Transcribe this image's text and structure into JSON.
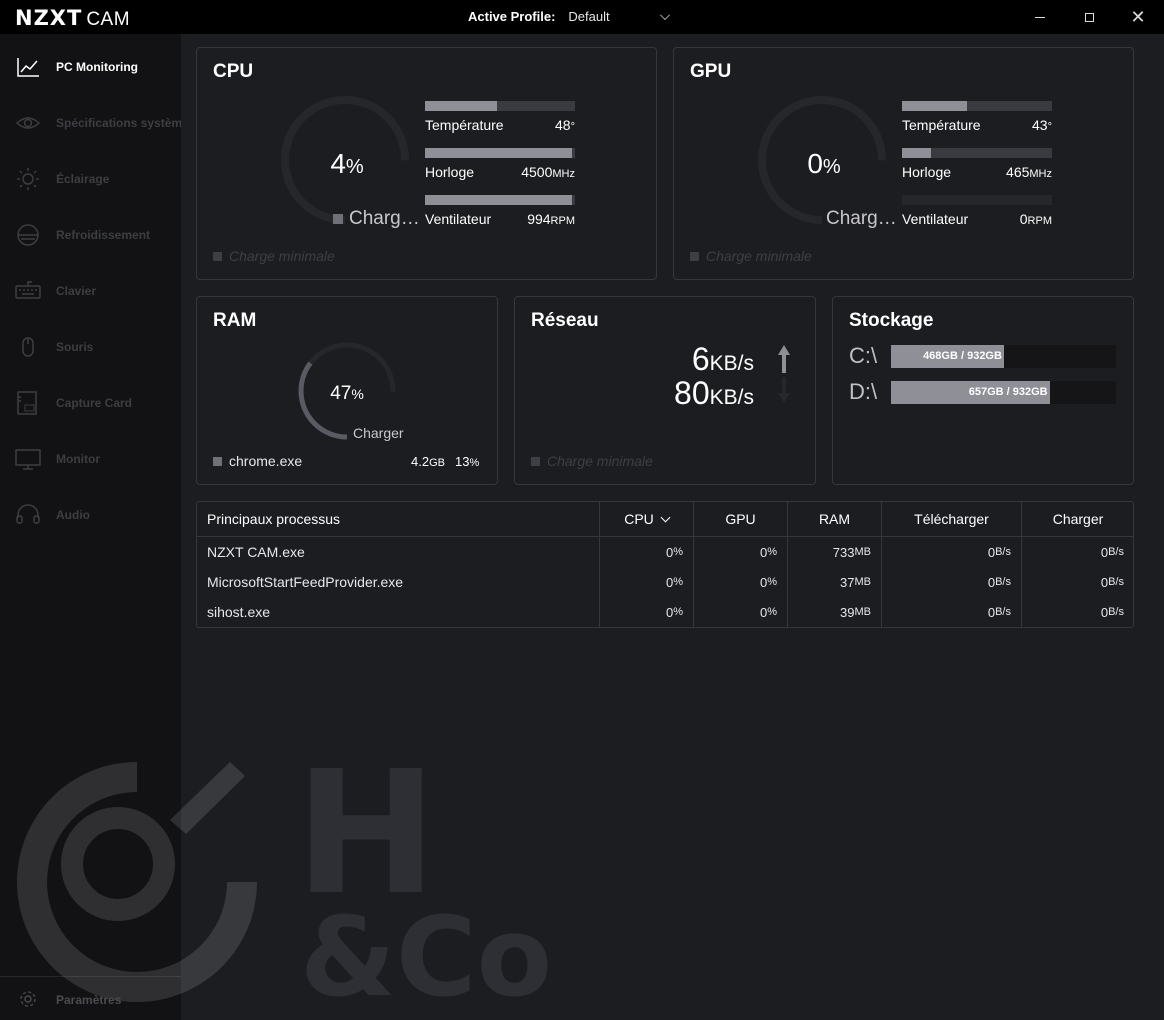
{
  "titlebar": {
    "brand": "NZXT",
    "app": "CAM",
    "profile_label": "Active Profile:",
    "profile_value": "Default"
  },
  "sidebar": {
    "items": [
      {
        "label": "PC Monitoring",
        "icon": "chart-line-icon",
        "active": true
      },
      {
        "label": "Spécifications système",
        "icon": "eye-icon",
        "active": false
      },
      {
        "label": "Éclairage",
        "icon": "sun-icon",
        "active": false
      },
      {
        "label": "Refroidissement",
        "icon": "fan-icon",
        "active": false
      },
      {
        "label": "Clavier",
        "icon": "keyboard-icon",
        "active": false
      },
      {
        "label": "Souris",
        "icon": "mouse-icon",
        "active": false
      },
      {
        "label": "Capture Card",
        "icon": "capture-card-icon",
        "active": false
      },
      {
        "label": "Monitor",
        "icon": "monitor-icon",
        "active": false
      },
      {
        "label": "Audio",
        "icon": "headset-icon",
        "active": false
      }
    ],
    "settings_label": "Paramètres"
  },
  "cpu": {
    "title": "CPU",
    "load_value": "4",
    "load_unit": "%",
    "load_fraction": 0.04,
    "load_label": "Charg…",
    "minimal_label": "Charge minimale",
    "stats": [
      {
        "name": "Température",
        "value": "48",
        "unit": "°",
        "fraction": 0.48
      },
      {
        "name": "Horloge",
        "value": "4500",
        "unit": "MHz",
        "fraction": 1.0
      },
      {
        "name": "Ventilateur",
        "value": "994",
        "unit": "RPM",
        "fraction": 1.0
      }
    ]
  },
  "gpu": {
    "title": "GPU",
    "load_value": "0",
    "load_unit": "%",
    "load_fraction": 0.0,
    "load_label": "Charg…",
    "minimal_label": "Charge minimale",
    "stats": [
      {
        "name": "Température",
        "value": "43",
        "unit": "°",
        "fraction": 0.43
      },
      {
        "name": "Horloge",
        "value": "465",
        "unit": "MHz",
        "fraction": 0.19
      },
      {
        "name": "Ventilateur",
        "value": "0",
        "unit": "RPM",
        "fraction": 0.0
      }
    ]
  },
  "ram": {
    "title": "RAM",
    "value": "47",
    "unit": "%",
    "fraction": 0.47,
    "label": "Charger",
    "top_process": "chrome.exe",
    "top_process_mem": "4.2",
    "top_process_mem_unit": "GB",
    "top_process_pct": "13",
    "top_process_pct_unit": "%"
  },
  "network": {
    "title": "Réseau",
    "upload_value": "6",
    "upload_unit": "KB/s",
    "download_value": "80",
    "download_unit": "KB/s",
    "minimal_label": "Charge minimale"
  },
  "storage": {
    "title": "Stockage",
    "drives": [
      {
        "letter": "C:\\",
        "caption": "468GB / 932GB",
        "fraction": 0.502
      },
      {
        "letter": "D:\\",
        "caption": "657GB / 932GB",
        "fraction": 0.705
      }
    ]
  },
  "processes": {
    "headers": [
      "Principaux processus",
      "CPU",
      "GPU",
      "RAM",
      "Télécharger",
      "Charger"
    ],
    "rows": [
      {
        "name": "NZXT CAM.exe",
        "cpu": "0",
        "cpu_u": "%",
        "gpu": "0",
        "gpu_u": "%",
        "ram": "733",
        "ram_u": "MB",
        "dl": "0",
        "dl_u": "B/s",
        "ul": "0",
        "ul_u": "B/s"
      },
      {
        "name": "MicrosoftStartFeedProvider.exe",
        "cpu": "0",
        "cpu_u": "%",
        "gpu": "0",
        "gpu_u": "%",
        "ram": "37",
        "ram_u": "MB",
        "dl": "0",
        "dl_u": "B/s",
        "ul": "0",
        "ul_u": "B/s"
      },
      {
        "name": "sihost.exe",
        "cpu": "0",
        "cpu_u": "%",
        "gpu": "0",
        "gpu_u": "%",
        "ram": "39",
        "ram_u": "MB",
        "dl": "0",
        "dl_u": "B/s",
        "ul": "0",
        "ul_u": "B/s"
      }
    ]
  },
  "watermark": {
    "text_h": "H",
    "text_co": "&Co"
  },
  "colors": {
    "bar_fill": "#8e8f97",
    "bar_track": "#3a3b40",
    "card_border": "#36373c",
    "bg": "#1c1d21"
  }
}
